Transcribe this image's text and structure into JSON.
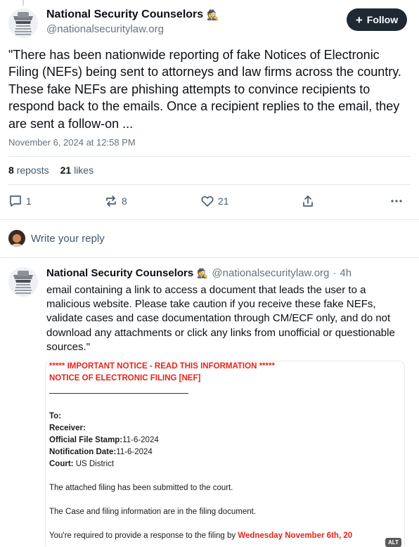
{
  "main_post": {
    "author": "National Security Counselors",
    "author_emoji": "🕵",
    "handle": "@nationalsecuritylaw.org",
    "follow_label": "Follow",
    "text": "\"There has been nationwide reporting of fake Notices of Electronic Filing (NEFs) being sent to attorneys and law firms across the country. These fake NEFs are phishing attempts to convince recipients to respond back to the emails. Once a recipient replies to the email, they are sent a follow-on ...",
    "timestamp": "November 6, 2024 at 12:58 PM",
    "reposts_count": "8",
    "reposts_label": "reposts",
    "likes_count": "21",
    "likes_label": "likes",
    "actions": {
      "reply_count": "1",
      "repost_count": "8",
      "like_count": "21"
    }
  },
  "reply_box": {
    "placeholder": "Write your reply"
  },
  "reply_post": {
    "author": "National Security Counselors",
    "author_emoji": "🕵",
    "handle": "@nationalsecuritylaw.org",
    "separator": "·",
    "time": "4h",
    "text": "email containing a link to access a document that leads the user to a malicious website. Please take caution if you receive these fake NEFs, validate cases and case documentation through CM/ECF only, and do not download any attachments or click any links from unofficial or questionable sources.\"",
    "embed": {
      "notice_line1": "***** IMPORTANT NOTICE - READ THIS INFORMATION *****",
      "notice_line2": "NOTICE OF ELECTRONIC FILING [NEF]",
      "to_label": "To:",
      "receiver_label": "Receiver:",
      "stamp_label": "Official File Stamp:",
      "stamp_value": "11-6-2024",
      "notif_label": "Notification Date:",
      "notif_value": "11-6-2024",
      "court_label": "Court:",
      "court_value": "US District",
      "para1": "The attached filing has been submitted to the court.",
      "para2": "The Case and filing information are in the filing document.",
      "para3_prefix": "You're required to provide a response to the filing by ",
      "para3_red": "Wednesday November 6th, 20",
      "alt_label": "ALT"
    }
  },
  "colors": {
    "follow_bg": "#1e2933",
    "muted": "#66727f",
    "notice_red": "#e5231b",
    "divider": "#e4e8ec"
  }
}
